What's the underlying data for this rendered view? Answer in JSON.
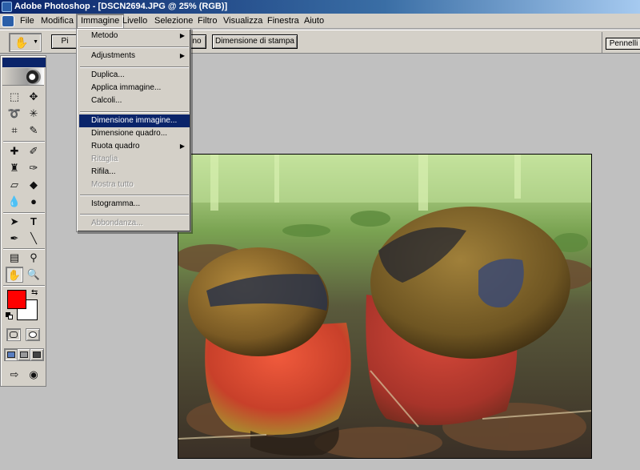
{
  "window": {
    "title": "Adobe Photoshop - [DSCN2694.JPG @ 25% (RGB)]"
  },
  "menubar": {
    "items": [
      "File",
      "Modifica",
      "Immagine",
      "Livello",
      "Selezione",
      "Filtro",
      "Visualizza",
      "Finestra",
      "Aiuto"
    ],
    "active_index": 2
  },
  "options": {
    "btn1": "Pi",
    "btn2": "no",
    "print_size_label": "Dimensione di stampa",
    "brushes_label": "Pennelli"
  },
  "image_menu": {
    "items": [
      {
        "label": "Metodo",
        "submenu": true,
        "state": "normal"
      },
      {
        "label": "Adjustments",
        "submenu": true,
        "state": "normal"
      },
      {
        "label": "Duplica...",
        "state": "normal"
      },
      {
        "label": "Applica immagine...",
        "state": "normal"
      },
      {
        "label": "Calcoli...",
        "state": "normal"
      },
      {
        "label": "Dimensione immagine...",
        "state": "highlighted"
      },
      {
        "label": "Dimensione quadro...",
        "state": "normal"
      },
      {
        "label": "Ruota quadro",
        "submenu": true,
        "state": "normal"
      },
      {
        "label": "Ritaglia",
        "state": "disabled"
      },
      {
        "label": "Rifila...",
        "state": "normal"
      },
      {
        "label": "Mostra tutto",
        "state": "disabled"
      },
      {
        "label": "Istogramma...",
        "state": "normal"
      },
      {
        "label": "Abbondanza...",
        "state": "disabled"
      }
    ]
  },
  "toolbox": {
    "foreground_color": "#ff0000",
    "background_color": "#ffffff"
  },
  "document": {
    "filename": "DSCN2694.JPG",
    "zoom": "25%",
    "mode": "RGB"
  },
  "icons": {
    "submenu_arrow": "▶",
    "dropdown_arrow": "▼"
  }
}
